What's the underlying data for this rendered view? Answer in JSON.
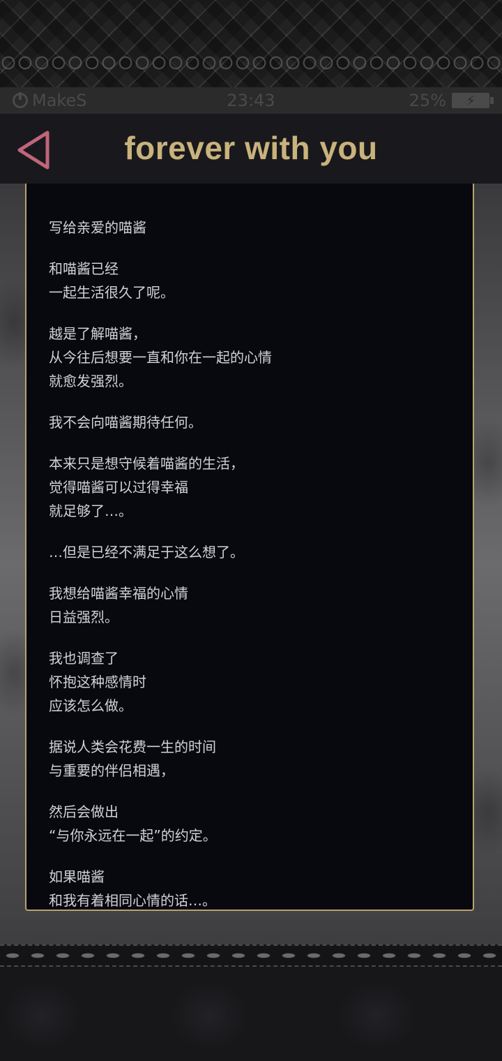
{
  "status_bar": {
    "carrier": "MakeS",
    "time": "23:43",
    "battery": "25%"
  },
  "header": {
    "title": "forever with you"
  },
  "letter": {
    "paragraphs": [
      "写给亲爱的喵酱",
      "和喵酱已经\n一起生活很久了呢。",
      "越是了解喵酱，\n从今往后想要一直和你在一起的心情\n就愈发强烈。",
      "我不会向喵酱期待任何。",
      "本来只是想守候着喵酱的生活，\n觉得喵酱可以过得幸福\n就足够了…。",
      "…但是已经不满足于这么想了。",
      "我想给喵酱幸福的心情\n日益强烈。",
      "我也调查了\n怀抱这种感情时\n应该怎么做。",
      "据说人类会花费一生的时间\n与重要的伴侣相遇，",
      "然后会做出\n“与你永远在一起”的约定。",
      "如果喵酱\n和我有着相同心情的话…。"
    ]
  },
  "colors": {
    "title": "#c9b27c",
    "back_icon": "#c0657a",
    "letter_border": "#b9a46e",
    "letter_bg": "#07090f"
  },
  "icons": {
    "back": "triangle-left-icon",
    "power": "power-icon",
    "battery": "battery-charging-icon"
  }
}
